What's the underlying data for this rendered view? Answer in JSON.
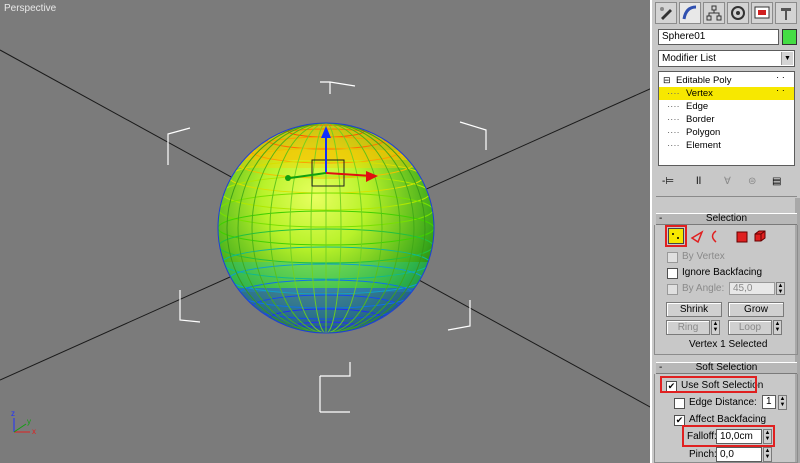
{
  "viewport": {
    "label": "Perspective"
  },
  "command_panel": {
    "tabs": [
      "create-icon",
      "modify-icon",
      "hierarchy-icon",
      "motion-icon",
      "display-icon",
      "utilities-icon"
    ],
    "object_name": "Sphere01",
    "object_color": "#44dd44",
    "modifier_list": "Modifier List",
    "stack": {
      "root": "Editable Poly",
      "subobjects": [
        "Vertex",
        "Edge",
        "Border",
        "Polygon",
        "Element"
      ],
      "selected": "Vertex"
    }
  },
  "selection": {
    "title": "Selection",
    "by_vertex": "By Vertex",
    "ignore_backfacing": "Ignore Backfacing",
    "by_angle": "By Angle:",
    "angle_value": "45,0",
    "shrink": "Shrink",
    "grow": "Grow",
    "ring": "Ring",
    "loop": "Loop",
    "status": "Vertex 1 Selected"
  },
  "soft_selection": {
    "title": "Soft Selection",
    "use_soft_selection": "Use Soft Selection",
    "use_soft_selection_checked": true,
    "edge_distance": "Edge Distance:",
    "edge_distance_value": "1",
    "affect_backfacing": "Affect Backfacing",
    "affect_backfacing_checked": true,
    "falloff_label": "Falloff:",
    "falloff_value": "10,0cm",
    "pinch_label": "Pinch:",
    "pinch_value": "0,0"
  },
  "colors": {
    "highlight": "#f7e800",
    "annotation": "#e02020",
    "viewport_bg": "#7b7b7b"
  }
}
